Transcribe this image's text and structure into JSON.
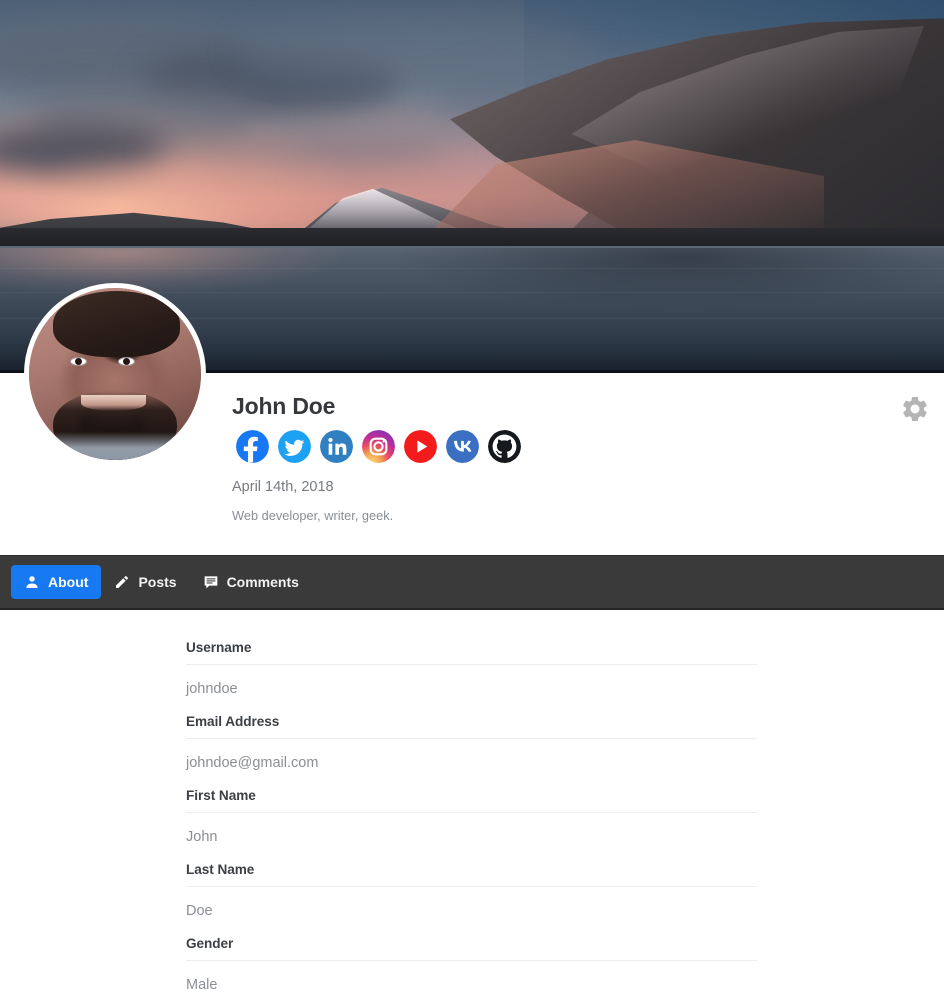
{
  "cover": {
    "alt": "mountain-lake-sunset-cover-photo"
  },
  "avatar": {
    "alt": "user-profile-photo"
  },
  "profile": {
    "name": "John Doe",
    "date": "April 14th, 2018",
    "bio": "Web developer, writer, geek.",
    "settings_icon": "gear-icon",
    "social_links": [
      {
        "name": "facebook",
        "icon": "facebook-icon",
        "color": "#1877F2"
      },
      {
        "name": "twitter",
        "icon": "twitter-icon",
        "color": "#1DA1F2"
      },
      {
        "name": "linkedin",
        "icon": "linkedin-icon",
        "color": "#2F7FC1"
      },
      {
        "name": "instagram",
        "icon": "instagram-icon",
        "color": "#E1306C"
      },
      {
        "name": "youtube",
        "icon": "youtube-icon",
        "color": "#F31C1C"
      },
      {
        "name": "vk",
        "icon": "vk-icon",
        "color": "#3B6FC4"
      },
      {
        "name": "github",
        "icon": "github-icon",
        "color": "#15181C"
      }
    ]
  },
  "tabs": {
    "active": "About",
    "accent_color": "#1779F2",
    "bar_color": "#3A3A3A",
    "items": [
      {
        "label": "About",
        "icon": "person-icon",
        "active": true
      },
      {
        "label": "Posts",
        "icon": "pencil-icon",
        "active": false
      },
      {
        "label": "Comments",
        "icon": "comment-icon",
        "active": false
      }
    ]
  },
  "about": {
    "fields": [
      {
        "label": "Username",
        "value": "johndoe"
      },
      {
        "label": "Email Address",
        "value": "johndoe@gmail.com"
      },
      {
        "label": "First Name",
        "value": "John"
      },
      {
        "label": "Last Name",
        "value": "Doe"
      },
      {
        "label": "Gender",
        "value": "Male"
      }
    ]
  }
}
